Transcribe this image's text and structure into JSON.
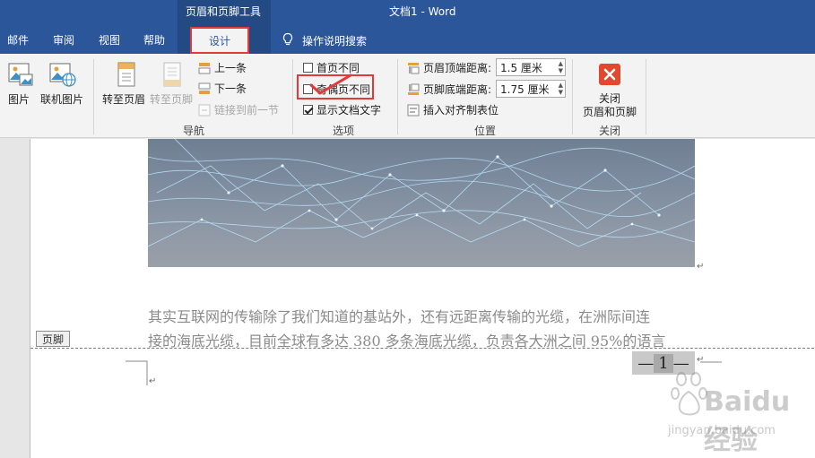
{
  "titlebar": {
    "context_group": "页眉和页脚工具",
    "document_title": "文档1  -  Word"
  },
  "tabs": [
    {
      "label": "邮件"
    },
    {
      "label": "审阅"
    },
    {
      "label": "视图"
    },
    {
      "label": "帮助"
    }
  ],
  "active_tab": "设计",
  "search": {
    "label": "操作说明搜索",
    "icon": "lightbulb-icon"
  },
  "ribbon": {
    "insert": {
      "picture": "图片",
      "online_picture": "联机图片"
    },
    "navigation": {
      "goto_header": "转至页眉",
      "goto_footer": "转至页脚",
      "previous": "上一条",
      "next": "下一条",
      "link_previous": "链接到前一节",
      "group": "导航"
    },
    "options": {
      "first_page_different": "首页不同",
      "odd_even_different": "奇偶页不同",
      "show_document_text": "显示文档文字",
      "group": "选项"
    },
    "position": {
      "header_top_label": "页眉顶端距离:",
      "header_top_value": "1.5 厘米",
      "footer_bottom_label": "页脚底端距离:",
      "footer_bottom_value": "1.75 厘米",
      "insert_align_tab": "插入对齐制表位",
      "group": "位置"
    },
    "close": {
      "label_line1": "关闭",
      "label_line2": "页眉和页脚",
      "group": "关闭"
    }
  },
  "document": {
    "paragraph_line1": "其实互联网的传输除了我们知道的基站外，还有远距离传输的光缆，在洲际间连",
    "paragraph_line2": "接的海底光缆，目前全球有多达 380 多条海底光缆，负责各大洲之间 95%的语言",
    "footer_tag": "页脚",
    "page_number": "1",
    "dash": "—"
  },
  "watermark": {
    "brand": "Baidu经验",
    "url": "jingyan.baidu.com"
  },
  "colors": {
    "title_blue": "#2b579a",
    "highlight_red": "#e23a3a"
  }
}
